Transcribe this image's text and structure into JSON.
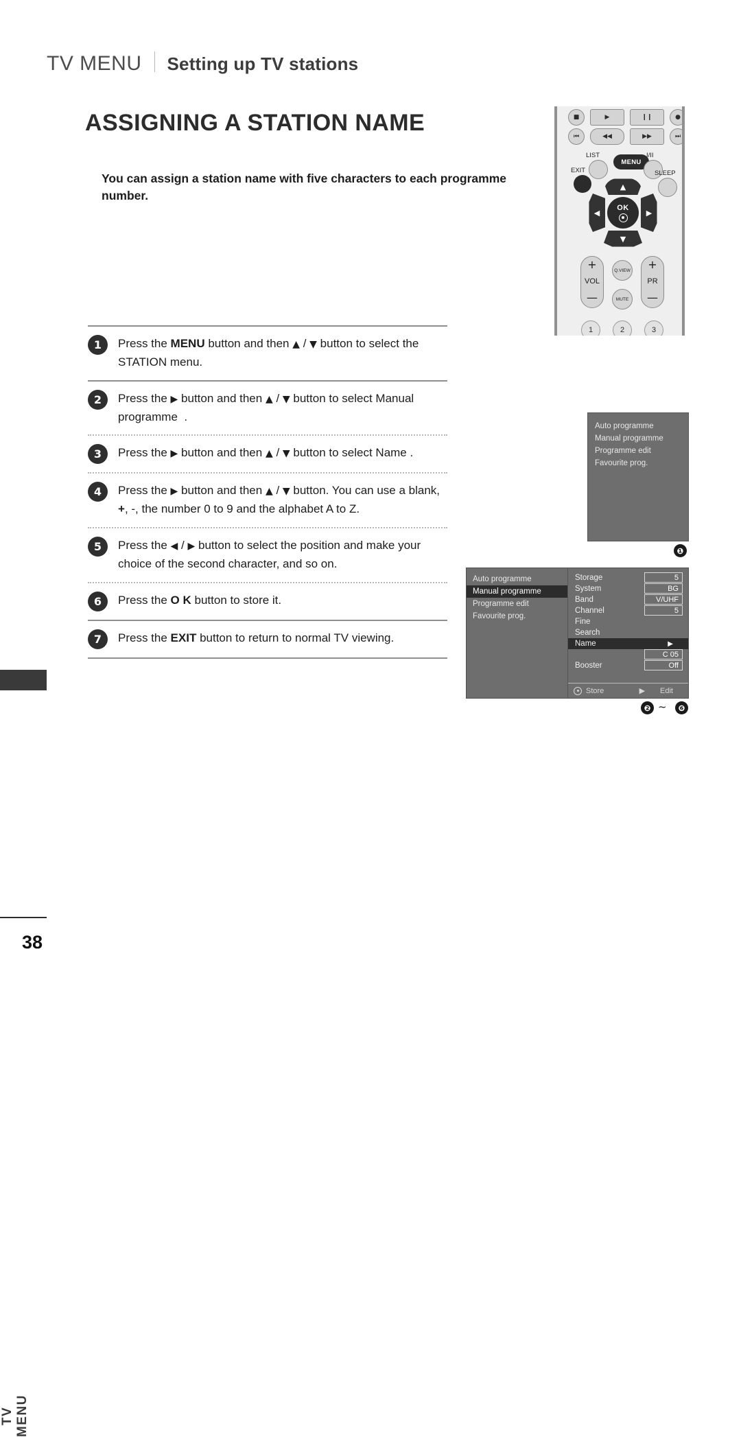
{
  "header": {
    "tv_menu": "TV MENU",
    "subtitle": "Setting up TV stations"
  },
  "main_title": "ASSIGNING A STATION NAME",
  "intro": "You can assign a station name with five characters to each programme number.",
  "steps": [
    {
      "num": "1",
      "html": "Press the <b>MENU</b> button and then <span class=\"gly\">▲</span> / <span class=\"gly\">▼</span> button to select the STATION menu.",
      "after": "solid"
    },
    {
      "num": "2",
      "html": "Press the <span class=\"gly\">▶</span> button and then <span class=\"gly\">▲</span> / <span class=\"gly\">▼</span> button to select Manual programme&nbsp;&nbsp;.",
      "after": "dotted"
    },
    {
      "num": "3",
      "html": "Press the <span class=\"gly\">▶</span> button and then <span class=\"gly\">▲</span> / <span class=\"gly\">▼</span> button to select Name .",
      "after": "dotted"
    },
    {
      "num": "4",
      "html": "Press the <span class=\"gly\">▶</span> button and then <span class=\"gly\">▲</span> / <span class=\"gly\">▼</span> button. You can use a blank, <b>+</b>, -, the number 0 to 9 and the alphabet A to Z.",
      "after": "dotted"
    },
    {
      "num": "5",
      "html": "Press the <span class=\"gly\">◀</span> / <span class=\"gly\">▶</span> button to select the position and make your choice of the second character, and so on.",
      "after": "dotted"
    },
    {
      "num": "6",
      "html": "Press the <b>O K</b> button to store it.",
      "after": "solid"
    },
    {
      "num": "7",
      "html": "Press the <b>EXIT</b> button to return to normal TV viewing.",
      "after": "solid"
    }
  ],
  "side_tab": {
    "label": "TV MENU"
  },
  "page_number": "38",
  "remote": {
    "transport_row1": [
      "■",
      "▶",
      "❙❙",
      "●"
    ],
    "transport_row2": [
      "⏮",
      "◀◀",
      "▶▶",
      "⏭"
    ],
    "list_label": "LIST",
    "exit_label": "EXIT",
    "menu_label": "MENU",
    "iii_label": "I/II",
    "sleep_label": "SLEEP",
    "ok_label": "OK",
    "vol_label": "VOL",
    "pr_label": "PR",
    "qview_label": "Q.VIEW",
    "mute_label": "MUTE",
    "plus": "+",
    "minus": "—",
    "numbers": [
      "1",
      "2",
      "3"
    ]
  },
  "osd_one": {
    "items": [
      "Auto programme",
      "Manual programme",
      "Programme edit",
      "Favourite prog."
    ],
    "callout": "❶"
  },
  "osd_two": {
    "left_items": [
      {
        "label": "Auto programme",
        "selected": false
      },
      {
        "label": "Manual programme",
        "selected": true
      },
      {
        "label": "Programme edit",
        "selected": false
      },
      {
        "label": "Favourite prog.",
        "selected": false
      }
    ],
    "fields": [
      {
        "label": "Storage",
        "value": "5",
        "selected": false,
        "arrow": ""
      },
      {
        "label": "System",
        "value": "BG",
        "selected": false,
        "arrow": ""
      },
      {
        "label": "Band",
        "value": "V/UHF",
        "selected": false,
        "arrow": ""
      },
      {
        "label": "Channel",
        "value": "5",
        "selected": false,
        "arrow": ""
      },
      {
        "label": "Fine",
        "value": "",
        "selected": false,
        "arrow": ""
      },
      {
        "label": "Search",
        "value": "",
        "selected": false,
        "arrow": ""
      },
      {
        "label": "Name",
        "value": "",
        "selected": true,
        "arrow": "▶"
      },
      {
        "label": "",
        "value": "C 05",
        "selected": false,
        "arrow": ""
      },
      {
        "label": "Booster",
        "value": "Off",
        "selected": false,
        "arrow": ""
      }
    ],
    "footer": {
      "store": "Store",
      "arrow": "▶",
      "edit": "Edit"
    },
    "callout_start": "❷",
    "callout_tilde": "~",
    "callout_end": "❻"
  }
}
